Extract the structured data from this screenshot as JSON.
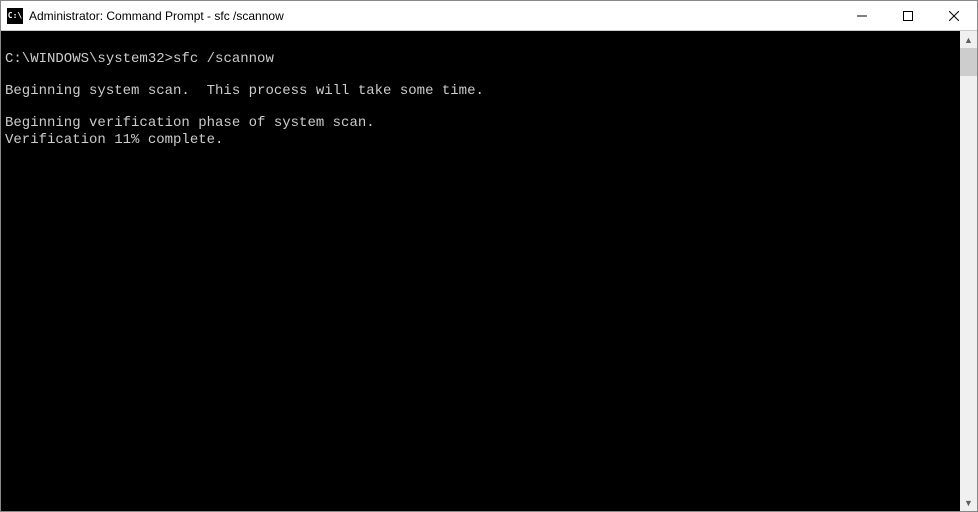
{
  "titlebar": {
    "icon_label": "C:\\",
    "title": "Administrator: Command Prompt - sfc  /scannow"
  },
  "terminal": {
    "prompt": "C:\\WINDOWS\\system32>",
    "command": "sfc /scannow",
    "lines": {
      "l1": "Beginning system scan.  This process will take some time.",
      "l2": "Beginning verification phase of system scan.",
      "l3": "Verification 11% complete."
    }
  }
}
